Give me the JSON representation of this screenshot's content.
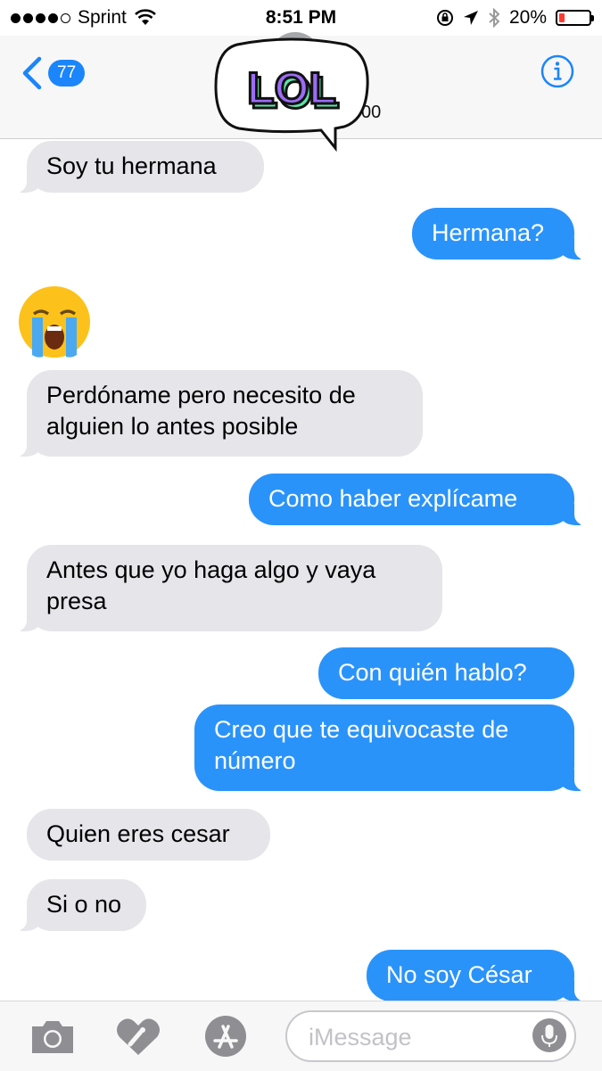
{
  "status_bar": {
    "carrier": "Sprint",
    "time": "8:51 PM",
    "battery_text": "20%",
    "battery_level": 0.2,
    "battery_color": "#ff3b30"
  },
  "nav": {
    "back_count": "77",
    "contact_name_fragment": "00",
    "sticker_text": "LOL",
    "accent_color": "#1b85fb"
  },
  "messages": [
    {
      "direction": "in",
      "text": "Soy tu hermana"
    },
    {
      "direction": "out",
      "text": "Hermana?"
    },
    {
      "direction": "in",
      "emoji": "crying-face-emoji"
    },
    {
      "direction": "in",
      "text": "Perdóname pero necesito de\nalguien lo antes posible"
    },
    {
      "direction": "out",
      "text": "Como haber explícame"
    },
    {
      "direction": "in",
      "text": "Antes que yo haga algo y vaya\npresa"
    },
    {
      "direction": "out",
      "text": "Con quién hablo?"
    },
    {
      "direction": "out",
      "text": "Creo que te equivocaste de\nnúmero"
    },
    {
      "direction": "in",
      "text": "Quien eres cesar"
    },
    {
      "direction": "in",
      "text": "Si o no"
    },
    {
      "direction": "out",
      "text": "No soy César"
    }
  ],
  "input_bar": {
    "placeholder": "iMessage",
    "icons": [
      "camera-icon",
      "digital-touch-icon",
      "app-store-icon",
      "microphone-icon"
    ]
  }
}
